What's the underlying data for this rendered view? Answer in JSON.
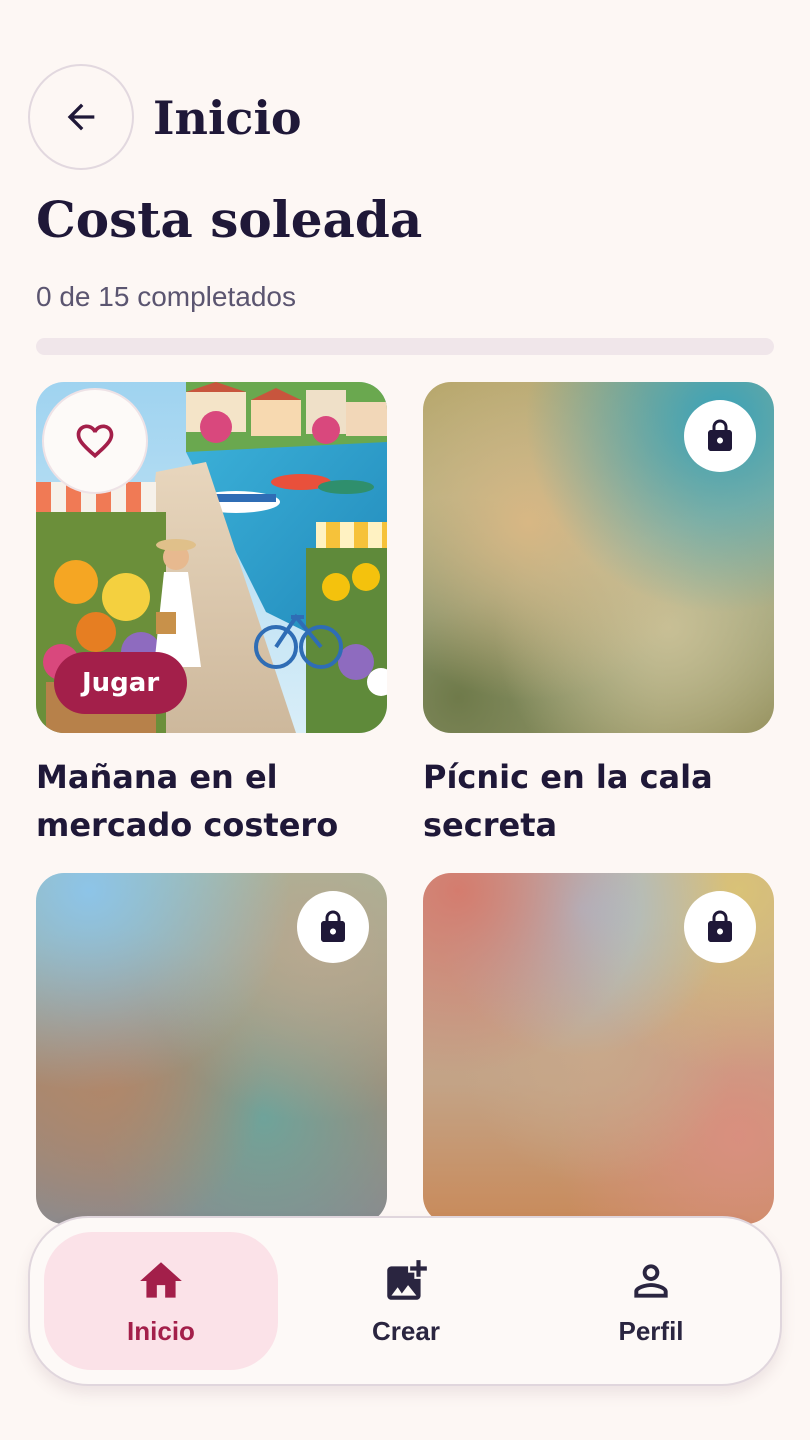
{
  "header": {
    "title": "Inicio"
  },
  "collection": {
    "title": "Costa soleada",
    "progress_text": "0 de 15 completados",
    "progress_fraction": 0
  },
  "puzzles": [
    {
      "title": "Mañana en el mercado costero",
      "locked": false,
      "play_label": "Jugar"
    },
    {
      "title": "Pícnic en la cala secreta",
      "locked": true
    },
    {
      "title": "",
      "locked": true
    },
    {
      "title": "",
      "locked": true
    }
  ],
  "bottom_nav": {
    "items": [
      {
        "label": "Inicio",
        "icon": "home-icon",
        "active": true
      },
      {
        "label": "Crear",
        "icon": "add-photo-icon",
        "active": false
      },
      {
        "label": "Perfil",
        "icon": "person-icon",
        "active": false
      }
    ]
  },
  "colors": {
    "accent": "#a31f4a",
    "background": "#fdf7f4",
    "text": "#1f1838",
    "nav_active_bg": "#fbe2e8"
  }
}
